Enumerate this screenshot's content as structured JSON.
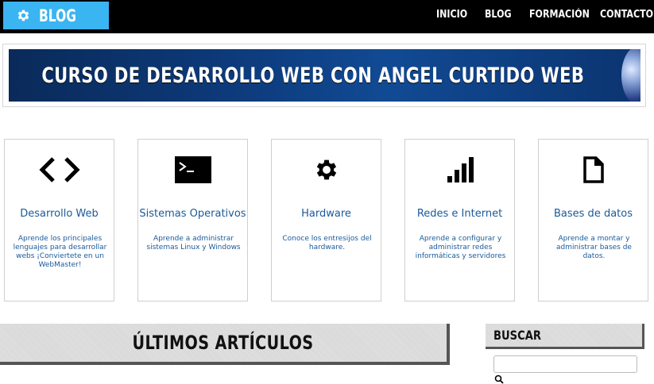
{
  "header": {
    "logo_text": "BLOG",
    "logo_icon": "gear-icon",
    "nav": [
      {
        "label": "INICIO"
      },
      {
        "label": "BLOG"
      },
      {
        "label": "FORMACIÓN"
      },
      {
        "label": "CONTACTO"
      }
    ]
  },
  "banner": {
    "title": "CURSO DE DESARROLLO WEB CON ANGEL CURTIDO WEB"
  },
  "cards": [
    {
      "icon": "code-icon",
      "title": "Desarrollo Web",
      "desc": "Aprende los principales lenguajes para desarrollar webs ¡Conviertete en un WebMaster!"
    },
    {
      "icon": "terminal-icon",
      "title": "Sistemas Operativos",
      "desc": "Aprende a administrar sistemas Linux y Windows"
    },
    {
      "icon": "gear-icon",
      "title": "Hardware",
      "desc": "Conoce los entresijos del hardware."
    },
    {
      "icon": "signal-bars-icon",
      "title": "Redes e Internet",
      "desc": "Aprende a configurar y administrar redes informáticas y servidores"
    },
    {
      "icon": "document-icon",
      "title": "Bases de datos",
      "desc": "Aprende a montar y administrar bases de datos."
    }
  ],
  "main": {
    "section_title": "ÚLTIMOS ARTÍCULOS"
  },
  "sidebar": {
    "search_title": "BUSCAR",
    "search_placeholder": "",
    "search_icon": "search-icon"
  },
  "colors": {
    "logo_bg": "#3bb4f2",
    "topbar_bg": "#000000",
    "card_text": "#1a5a9a",
    "banner_bg": "#0d3a7a"
  }
}
